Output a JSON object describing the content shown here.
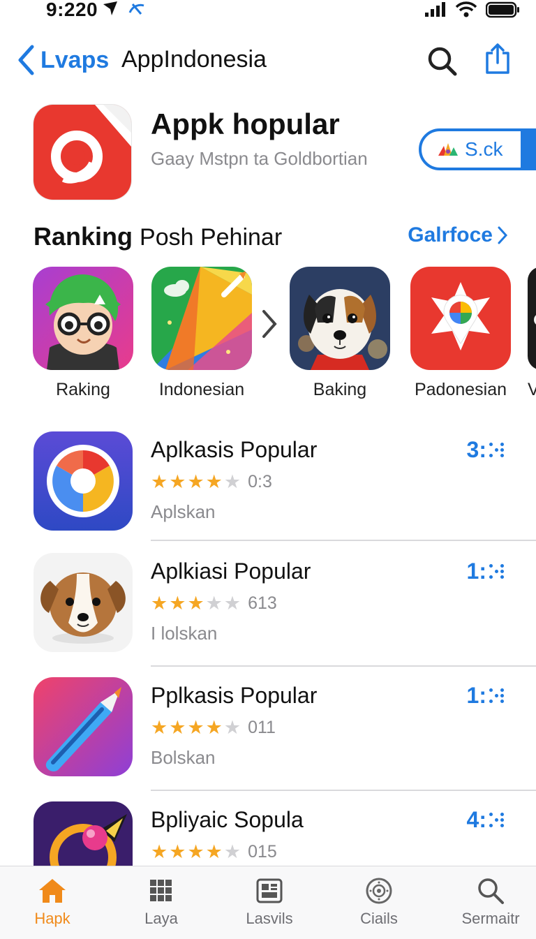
{
  "status_bar": {
    "time": "9:220"
  },
  "nav": {
    "back_label": "Lvaps",
    "title": "AppIndonesia"
  },
  "featured": {
    "title": "Appk hopular",
    "subtitle": "Gaay Mstpn ta Goldbortian",
    "button_label": "S.ck"
  },
  "ranking": {
    "title": "Ranking",
    "title_secondary": "Posh Pehinar",
    "see_all_label": "Galrfoce",
    "items": [
      {
        "label": "Raking",
        "icon": "green-hair-character-icon"
      },
      {
        "label": "Indonesian",
        "icon": "paper-plane-gradient-icon"
      },
      {
        "label": "Baking",
        "icon": "puppy-photo-icon"
      },
      {
        "label": "Padonesian",
        "icon": "red-map-pin-icon"
      },
      {
        "label": "V",
        "icon": "partial-app-icon"
      }
    ]
  },
  "apps": [
    {
      "title": "Aplkasis Popular",
      "stars": 4,
      "rating_count": "0:3",
      "category": "Aplskan",
      "rank": "3:",
      "icon": "chrome-like-icon"
    },
    {
      "title": "Aplkiasi Popular",
      "stars": 3,
      "rating_count": "613",
      "category": "I lolskan",
      "rank": "1:",
      "icon": "puppy-head-icon"
    },
    {
      "title": "Pplkasis Popular",
      "stars": 4,
      "rating_count": "011",
      "category": "Bolskan",
      "rank": "1:",
      "icon": "blue-pen-icon"
    },
    {
      "title": "Bpliyaic Sopula",
      "stars": 4,
      "rating_count": "015",
      "category": "",
      "rank": "4:",
      "icon": "orbit-ball-icon"
    }
  ],
  "tabs": [
    {
      "label": "Hapk",
      "icon": "home-icon",
      "active": true
    },
    {
      "label": "Laya",
      "icon": "grid-icon",
      "active": false
    },
    {
      "label": "Lasvils",
      "icon": "layout-icon",
      "active": false
    },
    {
      "label": "Ciails",
      "icon": "target-icon",
      "active": false
    },
    {
      "label": "Sermaitr",
      "icon": "search-icon",
      "active": false
    }
  ],
  "colors": {
    "accent": "#1f7ae0",
    "star": "#f5a623",
    "tab_active": "#f08a1a"
  }
}
